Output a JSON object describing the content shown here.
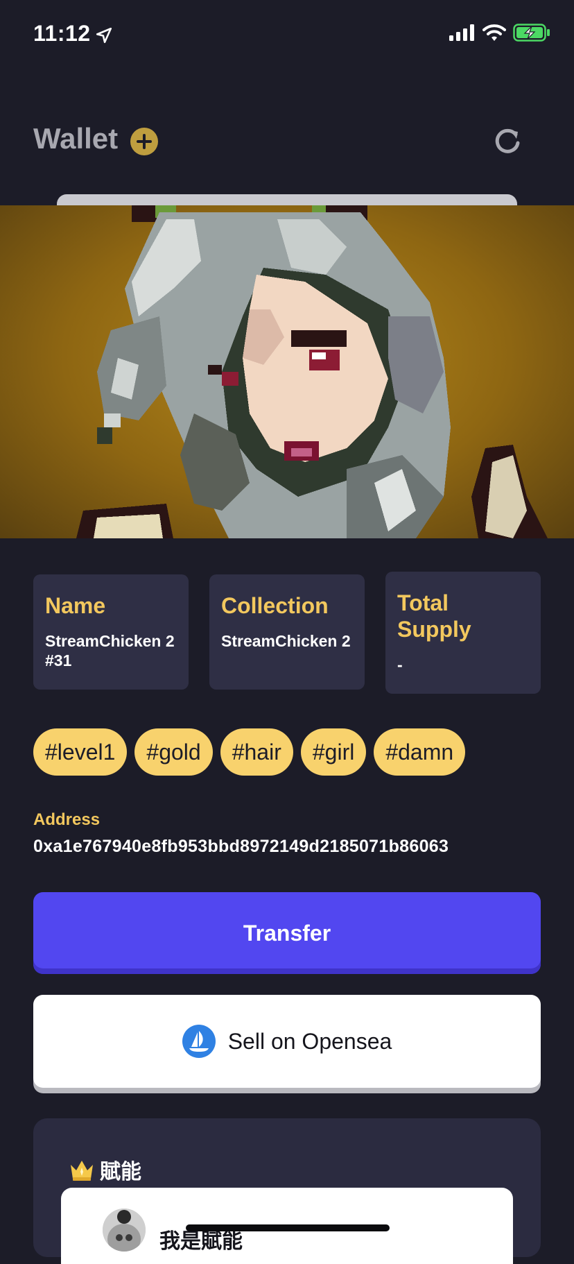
{
  "status": {
    "time": "11:12"
  },
  "header": {
    "title": "Wallet"
  },
  "details": [
    {
      "label": "Name",
      "value": "StreamChicken 2 #31"
    },
    {
      "label": "Collection",
      "value": "StreamChicken 2"
    },
    {
      "label": "Total Supply",
      "value": "-"
    }
  ],
  "tags": [
    "#level1",
    "#gold",
    "#hair",
    "#girl",
    "#damn"
  ],
  "address": {
    "label": "Address",
    "value": "0xa1e767940e8fb953bbd8972149d2185071b86063"
  },
  "actions": {
    "transfer_label": "Transfer",
    "sell_label": "Sell on Opensea"
  },
  "empower": {
    "title": "賦能",
    "item_name": "我是賦能"
  },
  "colors": {
    "accent": "#5247f0",
    "tag": "#f8d26d",
    "label": "#f3c85e",
    "background": "#1c1c28"
  },
  "icons": [
    "location-arrow-icon",
    "signal-icon",
    "wifi-icon",
    "battery-charging-icon",
    "add-icon",
    "refresh-icon",
    "opensea-icon",
    "crown-icon"
  ]
}
